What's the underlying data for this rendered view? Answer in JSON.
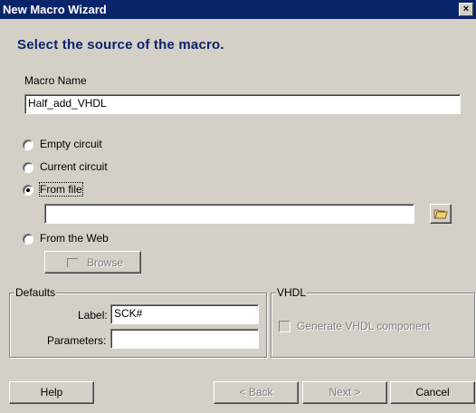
{
  "window": {
    "title": "New Macro Wizard",
    "close_glyph": "×"
  },
  "heading": "Select the source of the macro.",
  "macro_name": {
    "label": "Macro Name",
    "value": "Half_add_VHDL"
  },
  "source_options": [
    {
      "label": "Empty circuit",
      "selected": false
    },
    {
      "label": "Current circuit",
      "selected": false
    },
    {
      "label": "From file",
      "selected": true
    },
    {
      "label": "From the Web",
      "selected": false
    }
  ],
  "file_path": {
    "value": ""
  },
  "browse": {
    "label": "Browse",
    "enabled": false
  },
  "defaults": {
    "title": "Defaults",
    "label_field": {
      "label": "Label:",
      "value": "SCK#"
    },
    "parameters_field": {
      "label": "Parameters:",
      "value": ""
    }
  },
  "vhdl": {
    "title": "VHDL",
    "generate_label": "Generate VHDL component",
    "checked": false,
    "enabled": false
  },
  "buttons": {
    "help": "Help",
    "back": "< Back",
    "next": "Next >",
    "cancel": "Cancel"
  },
  "icons": {
    "folder": "folder-open-icon"
  }
}
